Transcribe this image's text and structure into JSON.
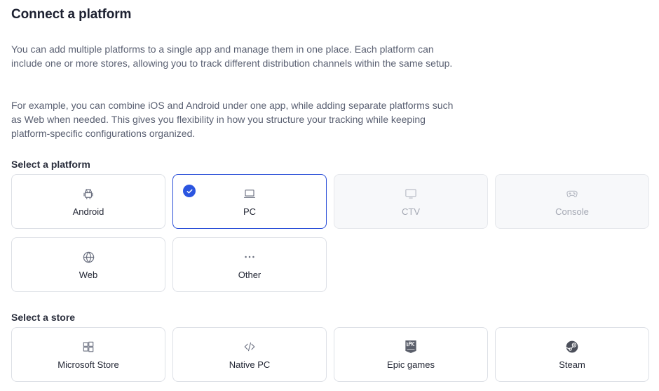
{
  "header": {
    "title": "Connect a platform"
  },
  "intro": {
    "paragraph_1": "You can add multiple platforms to a single app and manage them in one place. Each platform can include one or more stores, allowing you to track different distribution channels within the same setup.",
    "paragraph_2": "For example, you can combine iOS and Android under one app, while adding separate platforms such as Web when needed. This gives you flexibility in how you structure your tracking while keeping platform-specific configurations organized."
  },
  "platforms": {
    "label": "Select a platform",
    "selected": "PC",
    "items": [
      {
        "label": "Android",
        "icon": "android-icon",
        "state": "enabled"
      },
      {
        "label": "PC",
        "icon": "laptop-icon",
        "state": "selected"
      },
      {
        "label": "CTV",
        "icon": "tv-icon",
        "state": "disabled"
      },
      {
        "label": "Console",
        "icon": "gamepad-icon",
        "state": "disabled"
      },
      {
        "label": "Web",
        "icon": "globe-icon",
        "state": "enabled"
      },
      {
        "label": "Other",
        "icon": "more-icon",
        "state": "enabled"
      }
    ]
  },
  "stores": {
    "label": "Select a store",
    "items": [
      {
        "label": "Microsoft Store",
        "icon": "windows-icon"
      },
      {
        "label": "Native PC",
        "icon": "code-icon"
      },
      {
        "label": "Epic games",
        "icon": "epic-games-icon"
      },
      {
        "label": "Steam",
        "icon": "steam-icon"
      }
    ]
  },
  "colors": {
    "accent": "#2b55e0",
    "card_border": "#dde0e6",
    "disabled_bg": "#f7f8fa",
    "body_text": "#5a6072"
  }
}
